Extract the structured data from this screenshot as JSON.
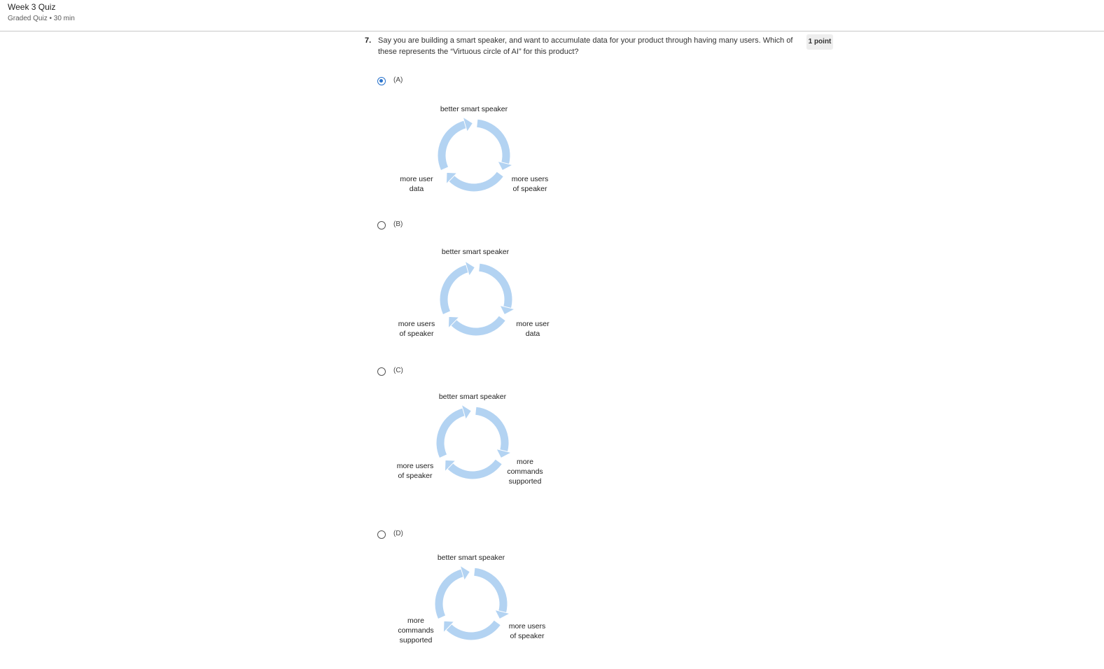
{
  "header": {
    "title": "Week 3 Quiz",
    "subtitle": "Graded Quiz • 30 min"
  },
  "question": {
    "number": "7.",
    "text": "Say you are building a smart speaker, and want to accumulate data for your product through having many users. Which of these represents the “Virtuous circle of AI” for this product?",
    "points": "1 point"
  },
  "colors": {
    "accent": "#2a73cc",
    "cycle_arrow": "#b3d3f2"
  },
  "options": [
    {
      "label": "(A)",
      "selected": true,
      "top": "better smart speaker",
      "left": "more user\ndata",
      "right": "more users\nof speaker"
    },
    {
      "label": "(B)",
      "selected": false,
      "top": "better smart speaker",
      "left": "more users\nof speaker",
      "right": "more user\ndata"
    },
    {
      "label": "(C)",
      "selected": false,
      "top": "better smart speaker",
      "left": "more users\nof speaker",
      "right": "more\ncommands\nsupported"
    },
    {
      "label": "(D)",
      "selected": false,
      "top": "better smart speaker",
      "left": "more\ncommands\nsupported",
      "right": "more users\nof speaker"
    }
  ]
}
